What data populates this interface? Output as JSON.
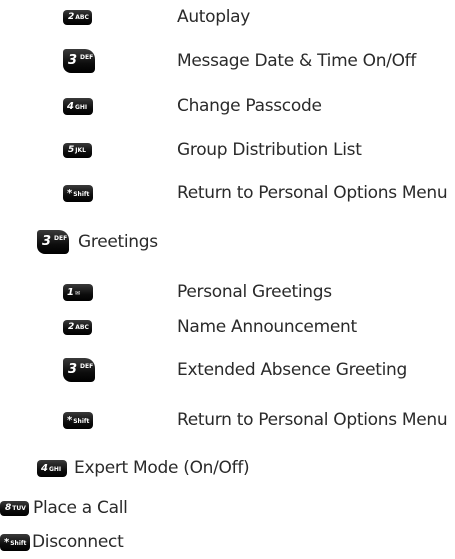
{
  "items": [
    {
      "digit": "2",
      "letters": "ABC",
      "label": "Autoplay"
    },
    {
      "digit": "3",
      "letters": "DEF",
      "label": "Message Date & Time On/Off"
    },
    {
      "digit": "4",
      "letters": "GHI",
      "label": "Change Passcode"
    },
    {
      "digit": "5",
      "letters": "JKL",
      "label": "Group Distribution List"
    },
    {
      "digit": "*",
      "letters": "Shift",
      "label": "Return to Personal Options Menu"
    }
  ],
  "greetings": {
    "digit": "3",
    "letters": "DEF",
    "label": "Greetings"
  },
  "greeting_items": [
    {
      "digit": "1",
      "letters": "✉",
      "label": "Personal Greetings"
    },
    {
      "digit": "2",
      "letters": "ABC",
      "label": "Name Announcement"
    },
    {
      "digit": "3",
      "letters": "DEF",
      "label": "Extended Absence Greeting"
    },
    {
      "digit": "*",
      "letters": "Shift",
      "label": "Return to Personal Options Menu"
    }
  ],
  "expert_mode": {
    "digit": "4",
    "letters": "GHI",
    "label": "Expert Mode (On/Off)"
  },
  "place_call": {
    "digit": "8",
    "letters": "TUV",
    "label": "Place a Call"
  },
  "disconnect": {
    "digit": "*",
    "letters": "Shift",
    "label": "Disconnect"
  }
}
